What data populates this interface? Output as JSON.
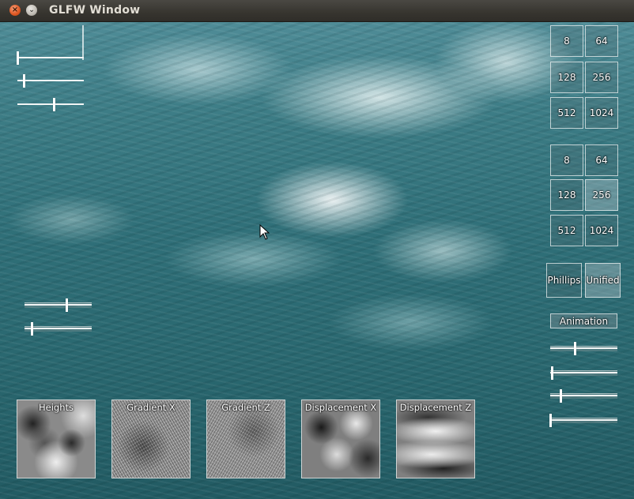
{
  "window": {
    "title": "GLFW Window"
  },
  "resolution_grids": [
    {
      "options": [
        "8",
        "64",
        "128",
        "256",
        "512",
        "1024"
      ]
    },
    {
      "options": [
        "8",
        "64",
        "128",
        "256",
        "512",
        "1024"
      ],
      "selected": "256"
    }
  ],
  "spectrum": {
    "options": [
      "Phillips",
      "Unified"
    ],
    "selected": "Unified"
  },
  "animation_button": "Animation",
  "sliders": {
    "left_top": [
      0.0,
      0.1,
      0.55
    ],
    "left_mid": [
      0.62,
      0.1
    ],
    "right": [
      0.36,
      0.02,
      0.15,
      0.0
    ]
  },
  "textures": [
    {
      "label": "Heights",
      "icon": "heightmap-texture"
    },
    {
      "label": "Gradient X",
      "icon": "gradient-x-texture"
    },
    {
      "label": "Gradient Z",
      "icon": "gradient-z-texture"
    },
    {
      "label": "Displacement X",
      "icon": "displacement-x-texture"
    },
    {
      "label": "Displacement Z",
      "icon": "displacement-z-texture"
    }
  ],
  "colors": {
    "ocean_deep": "#225b63",
    "ocean_light": "#4f8c97",
    "foam": "#ffffff"
  }
}
